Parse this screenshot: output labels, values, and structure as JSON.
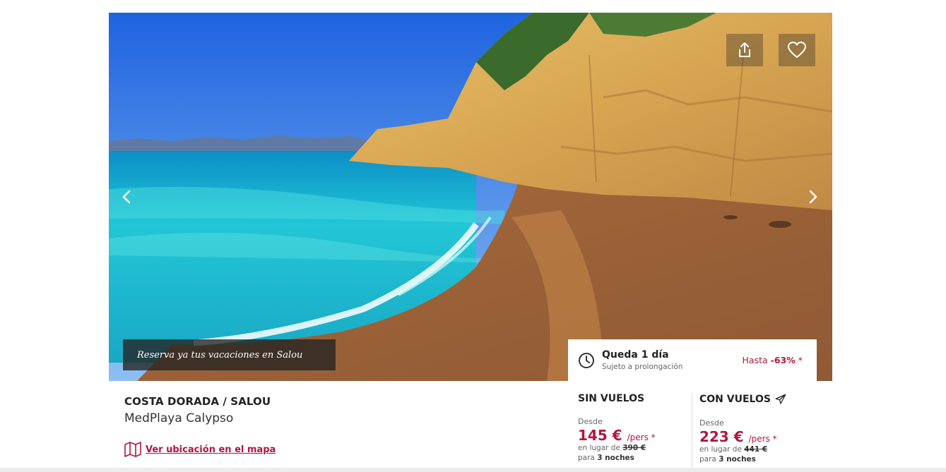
{
  "hero": {
    "caption": "Reserva ya tus vacaciones en Salou"
  },
  "icons": {
    "share": "share-icon",
    "favorite": "heart-icon",
    "prev": "chevron-left-icon",
    "next": "chevron-right-icon",
    "clock": "clock-icon",
    "map": "map-icon",
    "plane": "plane-icon"
  },
  "offer": {
    "region": "COSTA DORADA / SALOU",
    "hotel": "MedPlaya Calypso",
    "map_link": "Ver ubicación en el mapa"
  },
  "countdown": {
    "title": "Queda 1 día",
    "subtitle": "Sujeto a prolongación",
    "discount_prefix": "Hasta",
    "discount_value": "-63%",
    "discount_suffix": "*"
  },
  "pricing": {
    "sin_vuelos": {
      "label": "SIN VUELOS",
      "desde": "Desde",
      "price": "145 €",
      "per": "/pers *",
      "instead_prefix": "en lugar de",
      "old_price": "390 €",
      "nights_prefix": "para",
      "nights": "3 noches"
    },
    "con_vuelos": {
      "label": "CON VUELOS",
      "desde": "Desde",
      "price": "223 €",
      "per": "/pers *",
      "instead_prefix": "en lugar de",
      "old_price": "441 €",
      "nights_prefix": "para",
      "nights": "3 noches"
    }
  },
  "colors": {
    "accent": "#b0173f",
    "text": "#222222",
    "muted": "#666666"
  }
}
